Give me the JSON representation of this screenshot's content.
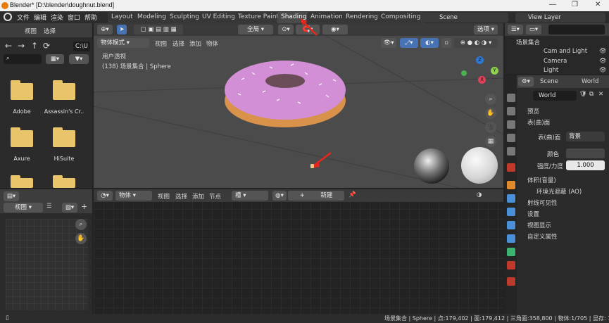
{
  "window": {
    "title": "Blender* [D:\\blender\\doughnut.blend]",
    "controls": [
      "—",
      "❐",
      "✕"
    ]
  },
  "menu": {
    "items": [
      "文件",
      "编辑",
      "渲染",
      "窗口",
      "帮助"
    ]
  },
  "workspace_tabs": [
    "Layout",
    "Modeling",
    "Sculpting",
    "UV Editing",
    "Texture Paint",
    "Shading",
    "Animation",
    "Rendering",
    "Compositing"
  ],
  "active_tab": "Shading",
  "scene": {
    "name": "Scene",
    "view_layer": "View Layer"
  },
  "file_browser": {
    "menu": [
      "视图",
      "选择"
    ],
    "path": "C:\\U",
    "search_placeholder": "",
    "folders": [
      "Adobe",
      "Assassin's Cr..",
      "Axure",
      "HiSuite",
      "",
      ""
    ]
  },
  "image_editor": {
    "view_label": "视图"
  },
  "viewport": {
    "mode": "物体模式",
    "menu": [
      "视图",
      "选择",
      "添加",
      "物体"
    ],
    "orientation": "全局",
    "options": "选项",
    "info_line1": "用户透视",
    "info_line2": "(138) 场景集合 | Sphere",
    "gizmo": {
      "z": "Z",
      "y": "Y",
      "x": "X"
    }
  },
  "shader_editor": {
    "type": "物体",
    "menu": [
      "视图",
      "选择",
      "添加",
      "节点"
    ],
    "slot": "槽",
    "new_button": "新建"
  },
  "outliner": {
    "root": "场景集合",
    "items": [
      "Cam and Light",
      "Camera",
      "Light"
    ]
  },
  "properties": {
    "breadcrumb_scene": "Scene",
    "breadcrumb_world": "World",
    "world_name": "World",
    "sections": [
      "预览",
      "表(曲)面"
    ],
    "surface_label": "表(曲)面",
    "surface_value": "背景",
    "color_label": "颜色",
    "strength_label": "强度/力度",
    "strength_value": "1.000",
    "lower_sections": [
      "体积(音量)",
      "环境光遮蔽 (AO)",
      "射线可见性",
      "设置",
      "视图显示",
      "自定义属性"
    ]
  },
  "status": {
    "text": "场景集合 | Sphere | 点:179,402 | 面:179,412 | 三角面:358,800 | 物体:1/705 | 显存: 185.3 Mi"
  },
  "colors": {
    "accent": "#4772b3",
    "active_tab": "#4a4a4a",
    "arrow": "#e8261b",
    "donut_icing": "#d38fd6",
    "donut_dough": "#d9924a"
  }
}
